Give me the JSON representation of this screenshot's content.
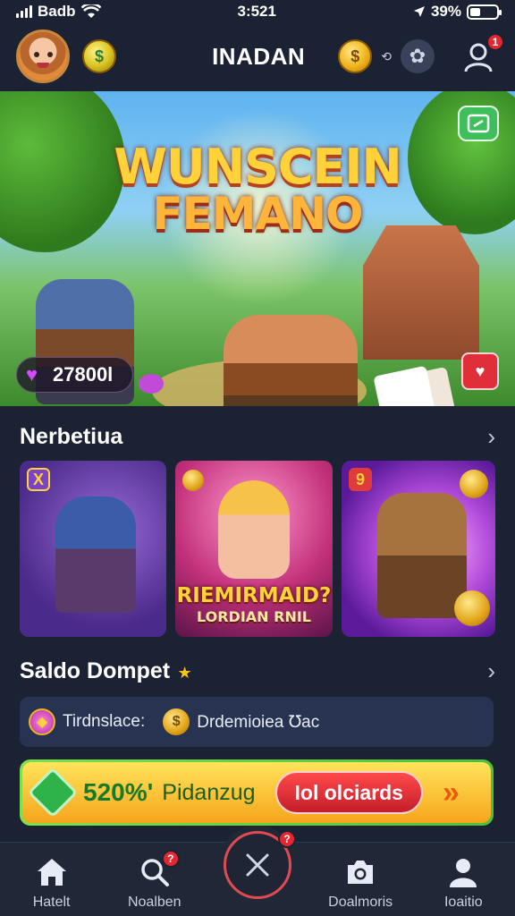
{
  "status": {
    "carrier": "Badb",
    "time": "3:521",
    "battery": "39%",
    "battery_level": 0.39
  },
  "header": {
    "title": "INADAN",
    "profile_badge": "1"
  },
  "hero": {
    "title_line1": "WUNSCEIN",
    "title_line2": "FEMANO",
    "gems": "27800l"
  },
  "section1": {
    "title": "Nerbetiua"
  },
  "games": [
    {
      "badge": "X"
    },
    {
      "title": "RIEMIRMAID?",
      "subtitle": "LORDIAN RNIL"
    },
    {
      "badge": "9"
    }
  ],
  "section2": {
    "title": "Saldo Dompet"
  },
  "info": {
    "left": "Tirdnslace:",
    "right": "Drdemioiea ℧ac"
  },
  "promo": {
    "percent": "520%'",
    "text": "Pidanzug",
    "button": "Iol olciards"
  },
  "nav": {
    "items": [
      {
        "label": "Hatelt",
        "icon": "home-icon"
      },
      {
        "label": "Noalben",
        "icon": "search-icon",
        "badge": "?"
      },
      {
        "label": "Doalmoris",
        "icon": "camera-icon"
      },
      {
        "label": "Ioaitio",
        "icon": "user-icon"
      }
    ],
    "center_badge": "?"
  },
  "colors": {
    "background": "#1b2233",
    "accent_red": "#e5262e",
    "promo_green": "#4fc03a",
    "coin_gold": "#f0b41c"
  }
}
